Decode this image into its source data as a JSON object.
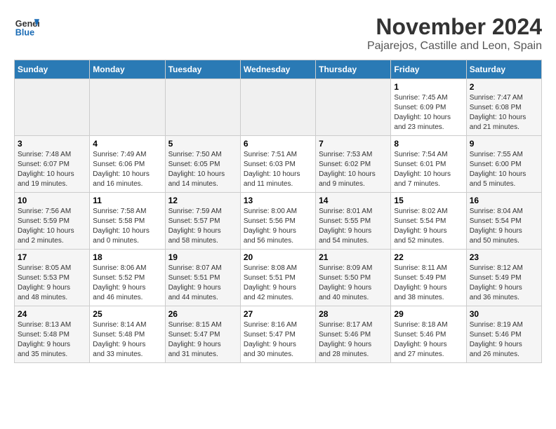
{
  "header": {
    "logo_general": "General",
    "logo_blue": "Blue",
    "month": "November 2024",
    "location": "Pajarejos, Castille and Leon, Spain"
  },
  "weekdays": [
    "Sunday",
    "Monday",
    "Tuesday",
    "Wednesday",
    "Thursday",
    "Friday",
    "Saturday"
  ],
  "weeks": [
    [
      {
        "day": "",
        "info": ""
      },
      {
        "day": "",
        "info": ""
      },
      {
        "day": "",
        "info": ""
      },
      {
        "day": "",
        "info": ""
      },
      {
        "day": "",
        "info": ""
      },
      {
        "day": "1",
        "info": "Sunrise: 7:45 AM\nSunset: 6:09 PM\nDaylight: 10 hours\nand 23 minutes."
      },
      {
        "day": "2",
        "info": "Sunrise: 7:47 AM\nSunset: 6:08 PM\nDaylight: 10 hours\nand 21 minutes."
      }
    ],
    [
      {
        "day": "3",
        "info": "Sunrise: 7:48 AM\nSunset: 6:07 PM\nDaylight: 10 hours\nand 19 minutes."
      },
      {
        "day": "4",
        "info": "Sunrise: 7:49 AM\nSunset: 6:06 PM\nDaylight: 10 hours\nand 16 minutes."
      },
      {
        "day": "5",
        "info": "Sunrise: 7:50 AM\nSunset: 6:05 PM\nDaylight: 10 hours\nand 14 minutes."
      },
      {
        "day": "6",
        "info": "Sunrise: 7:51 AM\nSunset: 6:03 PM\nDaylight: 10 hours\nand 11 minutes."
      },
      {
        "day": "7",
        "info": "Sunrise: 7:53 AM\nSunset: 6:02 PM\nDaylight: 10 hours\nand 9 minutes."
      },
      {
        "day": "8",
        "info": "Sunrise: 7:54 AM\nSunset: 6:01 PM\nDaylight: 10 hours\nand 7 minutes."
      },
      {
        "day": "9",
        "info": "Sunrise: 7:55 AM\nSunset: 6:00 PM\nDaylight: 10 hours\nand 5 minutes."
      }
    ],
    [
      {
        "day": "10",
        "info": "Sunrise: 7:56 AM\nSunset: 5:59 PM\nDaylight: 10 hours\nand 2 minutes."
      },
      {
        "day": "11",
        "info": "Sunrise: 7:58 AM\nSunset: 5:58 PM\nDaylight: 10 hours\nand 0 minutes."
      },
      {
        "day": "12",
        "info": "Sunrise: 7:59 AM\nSunset: 5:57 PM\nDaylight: 9 hours\nand 58 minutes."
      },
      {
        "day": "13",
        "info": "Sunrise: 8:00 AM\nSunset: 5:56 PM\nDaylight: 9 hours\nand 56 minutes."
      },
      {
        "day": "14",
        "info": "Sunrise: 8:01 AM\nSunset: 5:55 PM\nDaylight: 9 hours\nand 54 minutes."
      },
      {
        "day": "15",
        "info": "Sunrise: 8:02 AM\nSunset: 5:54 PM\nDaylight: 9 hours\nand 52 minutes."
      },
      {
        "day": "16",
        "info": "Sunrise: 8:04 AM\nSunset: 5:54 PM\nDaylight: 9 hours\nand 50 minutes."
      }
    ],
    [
      {
        "day": "17",
        "info": "Sunrise: 8:05 AM\nSunset: 5:53 PM\nDaylight: 9 hours\nand 48 minutes."
      },
      {
        "day": "18",
        "info": "Sunrise: 8:06 AM\nSunset: 5:52 PM\nDaylight: 9 hours\nand 46 minutes."
      },
      {
        "day": "19",
        "info": "Sunrise: 8:07 AM\nSunset: 5:51 PM\nDaylight: 9 hours\nand 44 minutes."
      },
      {
        "day": "20",
        "info": "Sunrise: 8:08 AM\nSunset: 5:51 PM\nDaylight: 9 hours\nand 42 minutes."
      },
      {
        "day": "21",
        "info": "Sunrise: 8:09 AM\nSunset: 5:50 PM\nDaylight: 9 hours\nand 40 minutes."
      },
      {
        "day": "22",
        "info": "Sunrise: 8:11 AM\nSunset: 5:49 PM\nDaylight: 9 hours\nand 38 minutes."
      },
      {
        "day": "23",
        "info": "Sunrise: 8:12 AM\nSunset: 5:49 PM\nDaylight: 9 hours\nand 36 minutes."
      }
    ],
    [
      {
        "day": "24",
        "info": "Sunrise: 8:13 AM\nSunset: 5:48 PM\nDaylight: 9 hours\nand 35 minutes."
      },
      {
        "day": "25",
        "info": "Sunrise: 8:14 AM\nSunset: 5:48 PM\nDaylight: 9 hours\nand 33 minutes."
      },
      {
        "day": "26",
        "info": "Sunrise: 8:15 AM\nSunset: 5:47 PM\nDaylight: 9 hours\nand 31 minutes."
      },
      {
        "day": "27",
        "info": "Sunrise: 8:16 AM\nSunset: 5:47 PM\nDaylight: 9 hours\nand 30 minutes."
      },
      {
        "day": "28",
        "info": "Sunrise: 8:17 AM\nSunset: 5:46 PM\nDaylight: 9 hours\nand 28 minutes."
      },
      {
        "day": "29",
        "info": "Sunrise: 8:18 AM\nSunset: 5:46 PM\nDaylight: 9 hours\nand 27 minutes."
      },
      {
        "day": "30",
        "info": "Sunrise: 8:19 AM\nSunset: 5:46 PM\nDaylight: 9 hours\nand 26 minutes."
      }
    ]
  ]
}
